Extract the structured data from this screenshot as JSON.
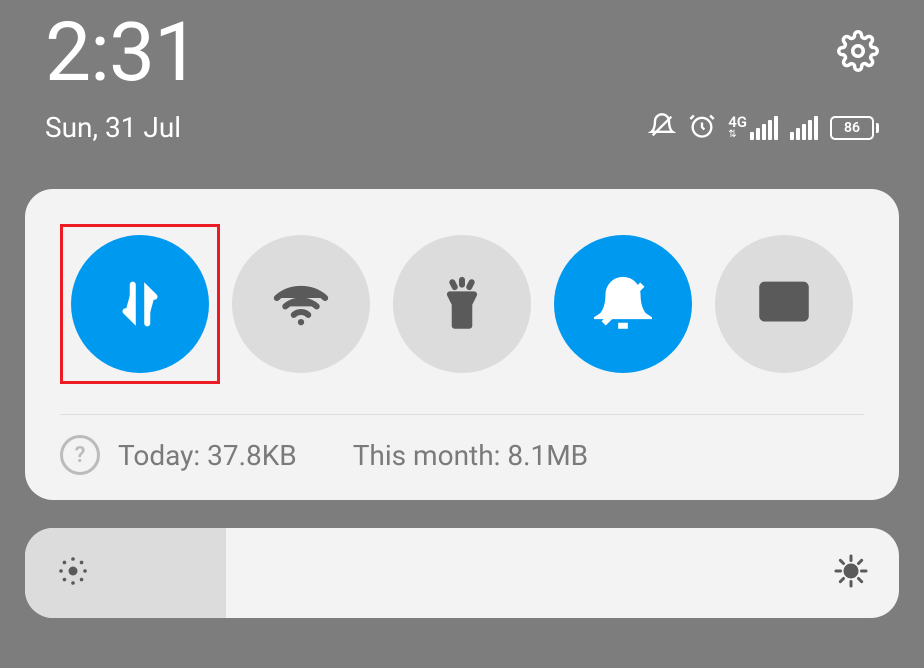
{
  "header": {
    "time": "2:31",
    "date": "Sun, 31 Jul",
    "battery_level": "86",
    "network_label": "4G"
  },
  "quick_toggles": [
    {
      "name": "mobile-data",
      "active": true,
      "highlighted": true
    },
    {
      "name": "wifi",
      "active": false
    },
    {
      "name": "flashlight",
      "active": false
    },
    {
      "name": "dnd",
      "active": true
    },
    {
      "name": "screenshot",
      "active": false
    }
  ],
  "data_usage": {
    "today_label": "Today: 37.8KB",
    "month_label": "This month: 8.1MB"
  },
  "brightness": {
    "level_percent": 23
  },
  "colors": {
    "accent": "#0099f0",
    "highlight": "#ed1c24"
  }
}
